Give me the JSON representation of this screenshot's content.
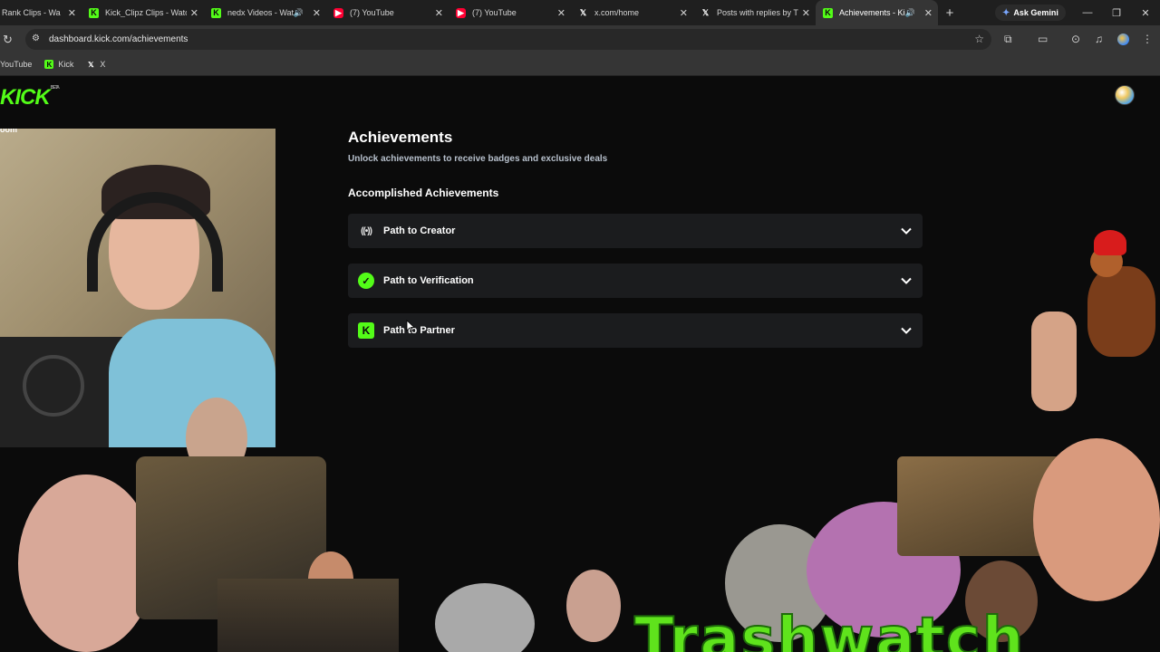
{
  "browser": {
    "tabs": [
      {
        "title": "Rank Clips - Wa",
        "favicon": "kick",
        "active": false
      },
      {
        "title": "Kick_Clipz Clips - Watc",
        "favicon": "kick",
        "active": false
      },
      {
        "title": "nedx Videos - Wat",
        "favicon": "kick",
        "active": false,
        "audio": true
      },
      {
        "title": "(7) YouTube",
        "favicon": "youtube",
        "active": false
      },
      {
        "title": "(7) YouTube",
        "favicon": "youtube",
        "active": false
      },
      {
        "title": "x.com/home",
        "favicon": "x",
        "active": false
      },
      {
        "title": "Posts with replies by Tr",
        "favicon": "x",
        "active": false
      },
      {
        "title": "Achievements - Kic",
        "favicon": "kick",
        "active": true,
        "audio": true
      }
    ],
    "gemini_label": "Ask Gemini",
    "url": "dashboard.kick.com/achievements",
    "bookmarks": [
      {
        "label": "YouTube",
        "favicon": "none"
      },
      {
        "label": "Kick",
        "favicon": "kick"
      },
      {
        "label": "X",
        "favicon": "x"
      }
    ]
  },
  "site": {
    "logo": "KICK",
    "logo_badge": "BETA"
  },
  "overlay": {
    "cam_label": "oom",
    "banner_text": "Trashwatch"
  },
  "achievements": {
    "title": "Achievements",
    "subtitle": "Unlock achievements to receive badges and exclusive deals",
    "section_title": "Accomplished Achievements",
    "items": [
      {
        "label": "Path to Creator",
        "icon": "broadcast-icon"
      },
      {
        "label": "Path to Verification",
        "icon": "verified-badge-icon"
      },
      {
        "label": "Path to Partner",
        "icon": "kick-partner-icon"
      }
    ]
  },
  "colors": {
    "kick_green": "#53fc18",
    "page_bg": "#0b0b0b",
    "card_bg": "#1b1c1e",
    "subtitle": "#b7c0cc"
  }
}
